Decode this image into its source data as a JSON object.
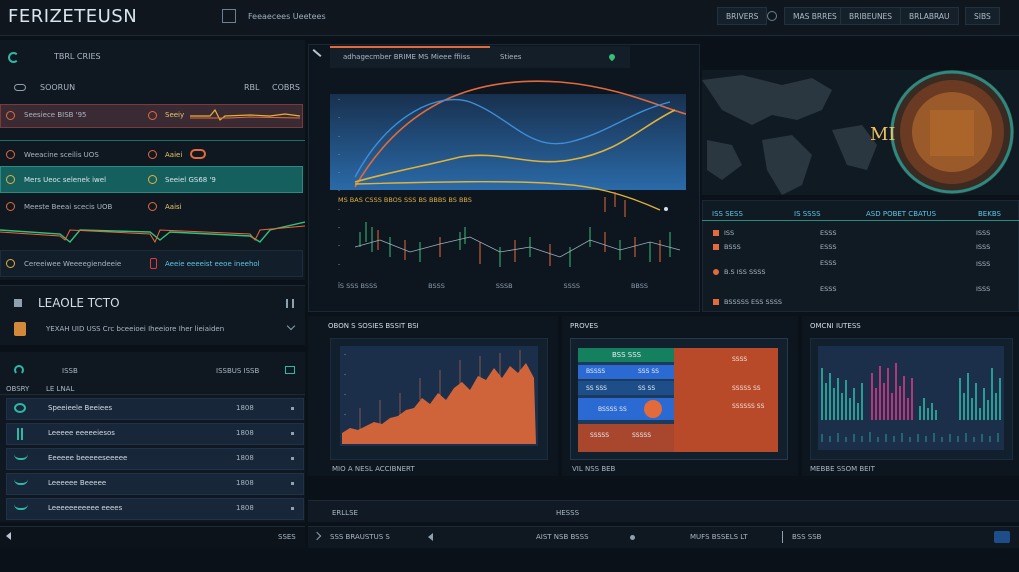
{
  "header": {
    "brand": "FERIZETEUSN",
    "menu_icon": "square-icon",
    "menu": "Feeaecees Ueetees",
    "nav": [
      "BRIVERS",
      "MAS BRRES",
      "BRIBEUNES",
      "BRLABRAU",
      "SIBS"
    ]
  },
  "left": {
    "title": "TBRL CRIES",
    "subtitle": "SOORUN",
    "col1": "RBL",
    "col2": "COBRS",
    "rows": [
      {
        "a": "Seesiece BISB '95",
        "b": "Seeiy"
      },
      {
        "a": "Weeacine sceilis UOS",
        "b": "Aaiei"
      },
      {
        "a": "Mers Ueoc selenek iwel",
        "b": "Seeiel GS68 '9"
      },
      {
        "a": "Meeste Beeai scecis UOB",
        "b": "Aaisi"
      },
      {
        "a": "Cereeiwee Weeeegiendeeie",
        "b": "Aeeie eeeeist eeoe ineehol"
      }
    ],
    "section_title": "LEAOLE TCTO",
    "section_sub": "YEXAH UID USS Crc bceeioei Iheeiore Iher lieiaiden",
    "list_label": "ISSB",
    "list_right": "ISSBUS ISSB",
    "list_header_a": "OBSRY",
    "list_header_b": "LE LNAL",
    "list": [
      {
        "name": "Speeieele Beeiees",
        "val": "1808"
      },
      {
        "name": "Leeeee eeeeeiesos",
        "val": "1808"
      },
      {
        "name": "Eeeeee beeeeeseeeee",
        "val": "1808"
      },
      {
        "name": "Leeeeee Beeeee",
        "val": "1808"
      },
      {
        "name": "Leeeeeeeeeee eeees",
        "val": "1808"
      }
    ],
    "footer_val": "SSES"
  },
  "center": {
    "tab1": "adhagecmber BRIME MS Mieee ffiiss",
    "tab2": "Stiees",
    "ylabels": [
      "-",
      "-",
      "-",
      "-",
      "-",
      "-",
      "-",
      "-",
      "-",
      "-",
      "-"
    ],
    "bottom_caption": "MS BAS CSSS BBOS SSS BS BBBS BS BBS",
    "xlabels": [
      "IS SSS BSSS",
      "BSSS",
      "SSSB",
      "SSSS",
      "BBSS"
    ]
  },
  "map_panel": {
    "headers": [
      "ISS SESS",
      "IS SSSS",
      "ASD POBET CBATUS",
      "BEKBS"
    ],
    "rows": [
      {
        "a": "ISS",
        "b": "ESSS",
        "c": "ISSS"
      },
      {
        "a": "BSSS",
        "b": "ESSS",
        "c": "ISSS"
      },
      {
        "a": "B.S ISS SSSS",
        "b": "ESSS",
        "c": "ISSS"
      },
      {
        "a": "BSSSSS ESS SSSS",
        "b": "ESSS",
        "c": "ISSS"
      }
    ]
  },
  "bottom": {
    "p1_title": "OBON S SOSIES BSSIT BSI",
    "p1_caption": "MIO A NESL ACCIBNERT",
    "p2_title": "PROVES",
    "p2_caption": "VIL NSS BEB",
    "p2_header": "BSS SSS",
    "p2_cells": [
      "BSSSS",
      "SSS SS",
      "SS SSS",
      "SS SS",
      "BSSSS SS",
      "SSSSS",
      "SSSSS",
      "SSSS",
      "SSSSS SS",
      "SSSSSS SS"
    ],
    "p3_title": "OMCNI IUTESS",
    "p3_caption": "MEBBE SSOM BEIT"
  },
  "footer_bar": {
    "left": "ERLLSE",
    "mid": "HESSS",
    "items": [
      "SSS BRAUSTUS S",
      "AIST NSB BSSS",
      "MUFS BSSELS LT",
      "BSS SSB"
    ]
  },
  "colors": {
    "accent": "#2b8a82",
    "orange": "#e36a3a",
    "yellow": "#e2b23a",
    "blue": "#3e8ed8"
  }
}
